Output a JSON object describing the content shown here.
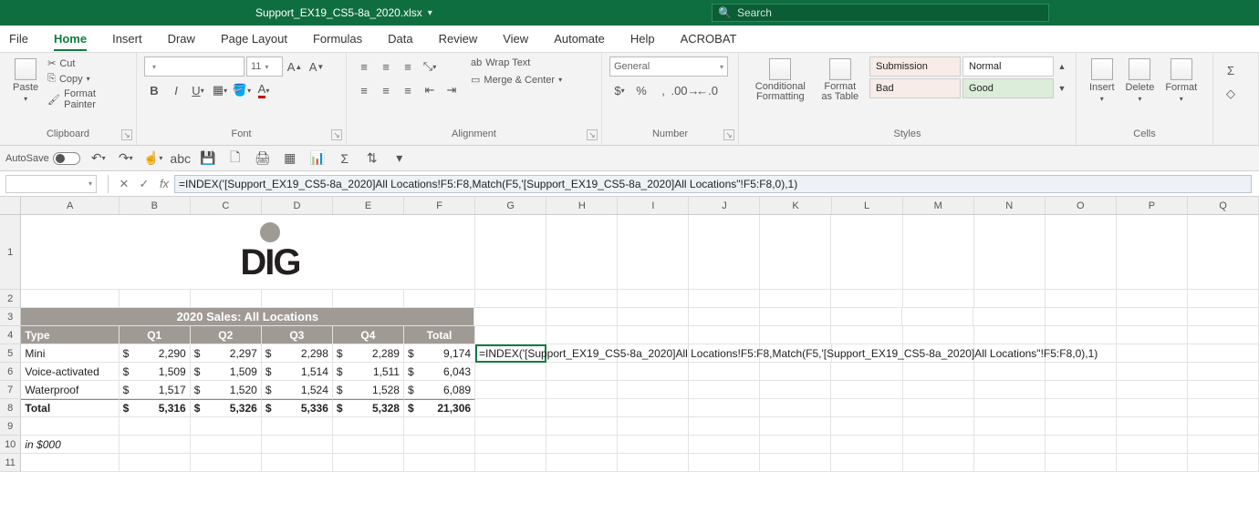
{
  "title": {
    "filename": "Support_EX19_CS5-8a_2020.xlsx"
  },
  "search": {
    "placeholder": "Search"
  },
  "tabs": [
    "File",
    "Home",
    "Insert",
    "Draw",
    "Page Layout",
    "Formulas",
    "Data",
    "Review",
    "View",
    "Automate",
    "Help",
    "ACROBAT"
  ],
  "active_tab": "Home",
  "ribbon": {
    "clipboard": {
      "paste": "Paste",
      "cut": "Cut",
      "copy": "Copy",
      "painter": "Format Painter",
      "label": "Clipboard"
    },
    "font": {
      "size": "11",
      "label": "Font"
    },
    "align": {
      "wrap": "Wrap Text",
      "merge": "Merge & Center",
      "label": "Alignment"
    },
    "number": {
      "format": "General",
      "label": "Number"
    },
    "styles": {
      "cond": "Conditional Formatting",
      "fast": "Format as Table",
      "cells": {
        "a": "Submission",
        "b": "Normal",
        "c": "Bad",
        "d": "Good"
      },
      "label": "Styles"
    },
    "cells": {
      "insert": "Insert",
      "delete": "Delete",
      "format": "Format",
      "label": "Cells"
    }
  },
  "quick": {
    "autosave": "AutoSave"
  },
  "fbar": {
    "formula": "=INDEX('[Support_EX19_CS5-8a_2020]All Locations!F5:F8,Match(F5,'[Support_EX19_CS5-8a_2020]All Locations\"!F5:F8,0),1)"
  },
  "columns": [
    "A",
    "B",
    "C",
    "D",
    "E",
    "F",
    "G",
    "H",
    "I",
    "J",
    "K",
    "L",
    "M",
    "N",
    "O",
    "P",
    "Q"
  ],
  "sheet": {
    "title": "2020 Sales: All Locations",
    "headers": {
      "type": "Type",
      "q1": "Q1",
      "q2": "Q2",
      "q3": "Q3",
      "q4": "Q4",
      "total": "Total"
    },
    "rows": [
      {
        "type": "Mini",
        "q1": "2,290",
        "q2": "2,297",
        "q3": "2,298",
        "q4": "2,289",
        "total": "9,174"
      },
      {
        "type": "Voice-activated",
        "q1": "1,509",
        "q2": "1,509",
        "q3": "1,514",
        "q4": "1,511",
        "total": "6,043"
      },
      {
        "type": "Waterproof",
        "q1": "1,517",
        "q2": "1,520",
        "q3": "1,524",
        "q4": "1,528",
        "total": "6,089"
      }
    ],
    "total": {
      "label": "Total",
      "q1": "5,316",
      "q2": "5,326",
      "q3": "5,336",
      "q4": "5,328",
      "total": "21,306"
    },
    "note": "in $000",
    "overflow_formula": "=INDEX('[Support_EX19_CS5-8a_2020]All Locations!F5:F8,Match(F5,'[Support_EX19_CS5-8a_2020]All Locations\"!F5:F8,0),1)"
  },
  "chart_data": {
    "type": "table",
    "title": "2020 Sales: All Locations",
    "note": "in $000",
    "columns": [
      "Type",
      "Q1",
      "Q2",
      "Q3",
      "Q4",
      "Total"
    ],
    "rows": [
      [
        "Mini",
        2290,
        2297,
        2298,
        2289,
        9174
      ],
      [
        "Voice-activated",
        1509,
        1509,
        1514,
        1511,
        6043
      ],
      [
        "Waterproof",
        1517,
        1520,
        1524,
        1528,
        6089
      ],
      [
        "Total",
        5316,
        5326,
        5336,
        5328,
        21306
      ]
    ]
  }
}
